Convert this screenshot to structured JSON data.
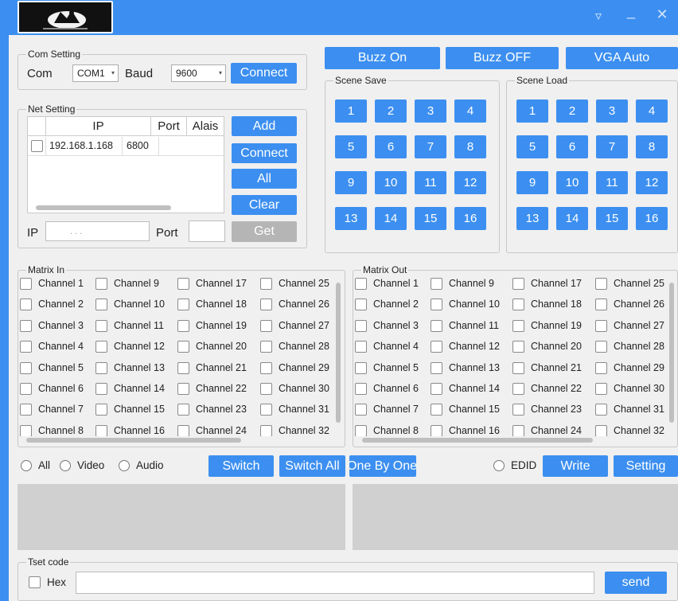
{
  "window": {
    "controls": [
      "dropdown-icon",
      "minimize-icon",
      "close-icon"
    ]
  },
  "com": {
    "title": "Com Setting",
    "com_label": "Com",
    "com_value": "COM1",
    "baud_label": "Baud",
    "baud_value": "9600",
    "connect": "Connect"
  },
  "net": {
    "title": "Net Setting",
    "headers": {
      "ip": "IP",
      "port": "Port",
      "alias": "Alais"
    },
    "rows": [
      {
        "ip": "192.168.1.168",
        "port": "6800",
        "alias": ""
      }
    ],
    "buttons": {
      "add": "Add",
      "connect": "Connect",
      "all": "All",
      "clear": "Clear",
      "get": "Get"
    },
    "ip_label": "IP",
    "ip_value": ".     .     .",
    "port_label": "Port"
  },
  "top": {
    "buzz_on": "Buzz On",
    "buzz_off": "Buzz OFF",
    "vga_auto": "VGA Auto"
  },
  "scene_save": {
    "title": "Scene Save",
    "buttons": [
      "1",
      "2",
      "3",
      "4",
      "5",
      "6",
      "7",
      "8",
      "9",
      "10",
      "11",
      "12",
      "13",
      "14",
      "15",
      "16"
    ]
  },
  "scene_load": {
    "title": "Scene Load",
    "buttons": [
      "1",
      "2",
      "3",
      "4",
      "5",
      "6",
      "7",
      "8",
      "9",
      "10",
      "11",
      "12",
      "13",
      "14",
      "15",
      "16"
    ]
  },
  "matrix_in": {
    "title": "Matrix In",
    "channels": [
      "Channel 1",
      "Channel 2",
      "Channel 3",
      "Channel 4",
      "Channel 5",
      "Channel 6",
      "Channel 7",
      "Channel 8",
      "Channel 9",
      "Channel 10",
      "Channel 11",
      "Channel 12",
      "Channel 13",
      "Channel 14",
      "Channel 15",
      "Channel 16",
      "Channel 17",
      "Channel 18",
      "Channel 19",
      "Channel 20",
      "Channel 21",
      "Channel 22",
      "Channel 23",
      "Channel 24",
      "Channel 25",
      "Channel 26",
      "Channel 27",
      "Channel 28",
      "Channel 29",
      "Channel 30",
      "Channel 31",
      "Channel 32"
    ]
  },
  "matrix_out": {
    "title": "Matrix Out",
    "channels": [
      "Channel 1",
      "Channel 2",
      "Channel 3",
      "Channel 4",
      "Channel 5",
      "Channel 6",
      "Channel 7",
      "Channel 8",
      "Channel 9",
      "Channel 10",
      "Channel 11",
      "Channel 12",
      "Channel 13",
      "Channel 14",
      "Channel 15",
      "Channel 16",
      "Channel 17",
      "Channel 18",
      "Channel 19",
      "Channel 20",
      "Channel 21",
      "Channel 22",
      "Channel 23",
      "Channel 24",
      "Channel 25",
      "Channel 26",
      "Channel 27",
      "Channel 28",
      "Channel 29",
      "Channel 30",
      "Channel 31",
      "Channel 32"
    ]
  },
  "mode": {
    "all": "All",
    "video": "Video",
    "audio": "Audio"
  },
  "actions": {
    "switch": "Switch",
    "switch_all": "Switch All",
    "one_by_one": "One By One",
    "edid": "EDID",
    "write": "Write",
    "setting": "Setting"
  },
  "test": {
    "title": "Tset code",
    "hex": "Hex",
    "send": "send"
  }
}
